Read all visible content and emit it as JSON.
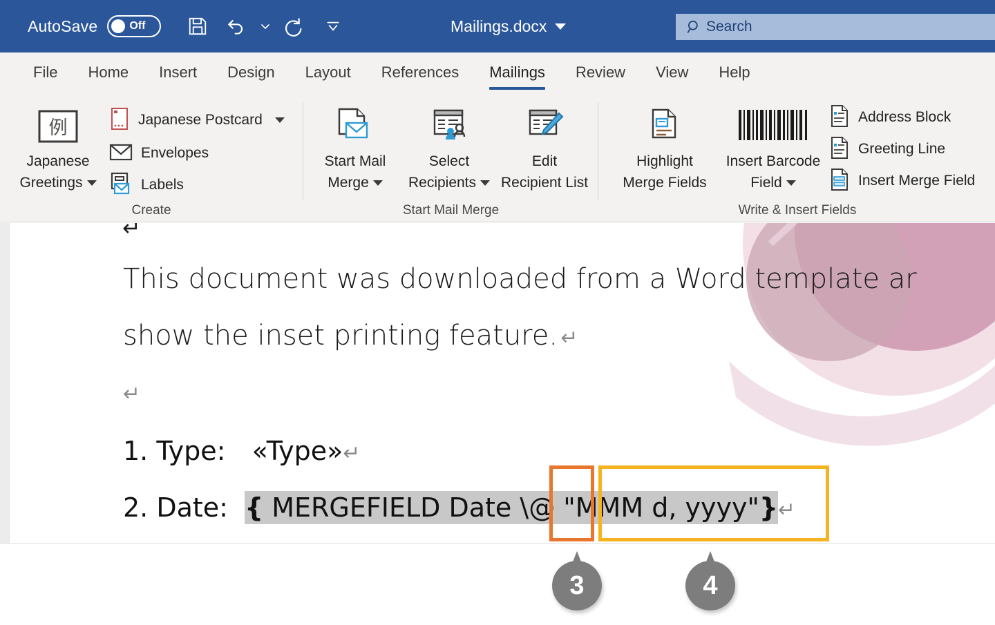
{
  "titlebar": {
    "autosave_label": "AutoSave",
    "autosave_state": "Off",
    "document_title": "Mailings.docx",
    "search_placeholder": "Search",
    "background_color": "#2b579a",
    "icons": [
      "save-icon",
      "undo-icon",
      "undo-dropdown-icon",
      "redo-icon",
      "customize-qat-icon"
    ]
  },
  "tabs": [
    {
      "label": "File",
      "active": false
    },
    {
      "label": "Home",
      "active": false
    },
    {
      "label": "Insert",
      "active": false
    },
    {
      "label": "Design",
      "active": false
    },
    {
      "label": "Layout",
      "active": false
    },
    {
      "label": "References",
      "active": false
    },
    {
      "label": "Mailings",
      "active": true
    },
    {
      "label": "Review",
      "active": false
    },
    {
      "label": "View",
      "active": false
    },
    {
      "label": "Help",
      "active": false
    }
  ],
  "ribbon": {
    "accent_color": "#2b579a",
    "groups": [
      {
        "name": "Create",
        "label": "Create",
        "big_buttons": [
          {
            "label_line1": "Japanese",
            "label_line2": "Greetings",
            "has_dropdown": true,
            "icon": "japanese-greetings-icon"
          }
        ],
        "small_items": [
          {
            "label": "Japanese Postcard",
            "has_dropdown": true,
            "icon": "japanese-postcard-icon"
          },
          {
            "label": "Envelopes",
            "has_dropdown": false,
            "icon": "envelope-icon"
          },
          {
            "label": "Labels",
            "has_dropdown": false,
            "icon": "labels-icon"
          }
        ]
      },
      {
        "name": "Start Mail Merge",
        "label": "Start Mail Merge",
        "big_buttons": [
          {
            "label_line1": "Start Mail",
            "label_line2": "Merge",
            "has_dropdown": true,
            "icon": "start-mail-merge-icon"
          },
          {
            "label_line1": "Select",
            "label_line2": "Recipients",
            "has_dropdown": true,
            "icon": "select-recipients-icon"
          },
          {
            "label_line1": "Edit",
            "label_line2": "Recipient List",
            "has_dropdown": false,
            "icon": "edit-recipient-list-icon"
          }
        ],
        "small_items": []
      },
      {
        "name": "Write & Insert Fields",
        "label": "Write & Insert Fields",
        "big_buttons": [
          {
            "label_line1": "Highlight",
            "label_line2": "Merge Fields",
            "has_dropdown": false,
            "icon": "highlight-merge-fields-icon"
          },
          {
            "label_line1": "Insert Barcode",
            "label_line2": "Field",
            "has_dropdown": true,
            "icon": "insert-barcode-field-icon"
          }
        ],
        "small_items": [
          {
            "label": "Address Block",
            "has_dropdown": false,
            "icon": "address-block-icon"
          },
          {
            "label": "Greeting Line",
            "has_dropdown": false,
            "icon": "greeting-line-icon"
          },
          {
            "label": "Insert Merge Field",
            "has_dropdown": false,
            "icon": "insert-merge-field-icon"
          }
        ]
      }
    ]
  },
  "document": {
    "paragraph_line1": "This document was downloaded from a Word template ar",
    "paragraph_line2": "show the inset printing feature.",
    "pilcrow": "↵",
    "empty_paragraph_mark": "↵",
    "list": [
      {
        "number": "1.",
        "label": "Type:",
        "value": "«Type»",
        "mark": "↵"
      },
      {
        "number": "2.",
        "label": "Date:",
        "mark": "↵"
      }
    ],
    "field_code": {
      "open_brace": "{",
      "body": " MERGEFIELD Date ",
      "switch": "\\@",
      "format_switch": " \"MMM d, yyyy\"",
      "close_brace": "}",
      "highlight_color": "#c8c8c8"
    }
  },
  "annotations": {
    "box_orange_color": "#e8762c",
    "box_yellow_color": "#f5b41f",
    "callouts": [
      {
        "number": "3",
        "target": "switch-box"
      },
      {
        "number": "4",
        "target": "format-box"
      }
    ],
    "callout_color": "#7d7d7d"
  }
}
